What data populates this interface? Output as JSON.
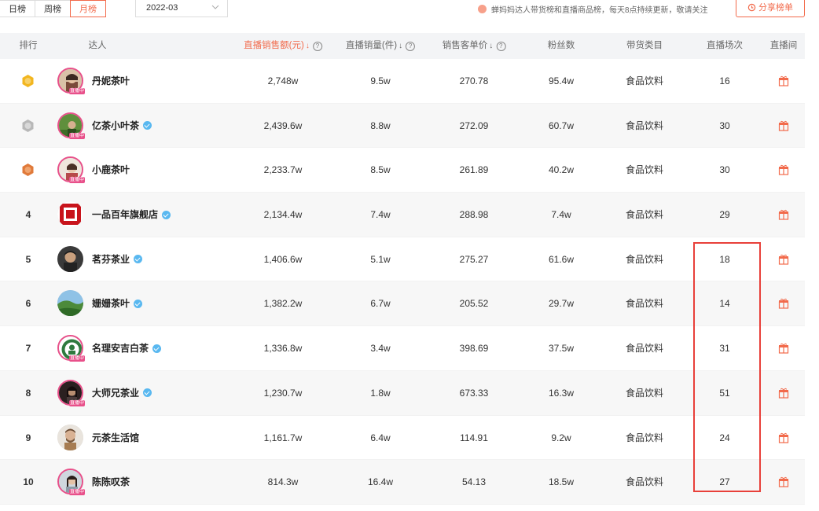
{
  "tabs": [
    {
      "label": "日榜",
      "active": false
    },
    {
      "label": "周榜",
      "active": false
    },
    {
      "label": "月榜",
      "active": true
    }
  ],
  "date_select": {
    "value": "2022-03"
  },
  "notice": "蝉妈妈达人带货榜和直播商品榜，每天8点持续更新，敬请关注",
  "share_button": "分享榜单",
  "columns": {
    "rank": "排行",
    "talent": "达人",
    "sales": "直播销售额(元)",
    "volume": "直播销量(件)",
    "unit_price": "销售客单价",
    "fans": "粉丝数",
    "category": "带货类目",
    "sessions": "直播场次",
    "room": "直播间"
  },
  "live_badge": "直播中",
  "rows": [
    {
      "rank": "1",
      "name": "丹妮茶叶",
      "verified": false,
      "live": true,
      "sales": "2,748w",
      "volume": "9.5w",
      "unit_price": "270.78",
      "fans": "95.4w",
      "category": "食品饮料",
      "sessions": "16"
    },
    {
      "rank": "2",
      "name": "亿茶小叶茶",
      "verified": true,
      "live": true,
      "sales": "2,439.6w",
      "volume": "8.8w",
      "unit_price": "272.09",
      "fans": "60.7w",
      "category": "食品饮料",
      "sessions": "30"
    },
    {
      "rank": "3",
      "name": "小鹿茶叶",
      "verified": false,
      "live": true,
      "sales": "2,233.7w",
      "volume": "8.5w",
      "unit_price": "261.89",
      "fans": "40.2w",
      "category": "食品饮料",
      "sessions": "30"
    },
    {
      "rank": "4",
      "name": "一品百年旗舰店",
      "verified": true,
      "live": false,
      "sales": "2,134.4w",
      "volume": "7.4w",
      "unit_price": "288.98",
      "fans": "7.4w",
      "category": "食品饮料",
      "sessions": "29"
    },
    {
      "rank": "5",
      "name": "茗芬茶业",
      "verified": true,
      "live": false,
      "sales": "1,406.6w",
      "volume": "5.1w",
      "unit_price": "275.27",
      "fans": "61.6w",
      "category": "食品饮料",
      "sessions": "18"
    },
    {
      "rank": "6",
      "name": "姗姗茶叶",
      "verified": true,
      "live": false,
      "sales": "1,382.2w",
      "volume": "6.7w",
      "unit_price": "205.52",
      "fans": "29.7w",
      "category": "食品饮料",
      "sessions": "14"
    },
    {
      "rank": "7",
      "name": "名理安吉白茶",
      "verified": true,
      "live": true,
      "sales": "1,336.8w",
      "volume": "3.4w",
      "unit_price": "398.69",
      "fans": "37.5w",
      "category": "食品饮料",
      "sessions": "31"
    },
    {
      "rank": "8",
      "name": "大师兄茶业",
      "verified": true,
      "live": true,
      "sales": "1,230.7w",
      "volume": "1.8w",
      "unit_price": "673.33",
      "fans": "16.3w",
      "category": "食品饮料",
      "sessions": "51"
    },
    {
      "rank": "9",
      "name": "元茶生活馆",
      "verified": false,
      "live": false,
      "sales": "1,161.7w",
      "volume": "6.4w",
      "unit_price": "114.91",
      "fans": "9.2w",
      "category": "食品饮料",
      "sessions": "24"
    },
    {
      "rank": "10",
      "name": "陈陈叹茶",
      "verified": false,
      "live": true,
      "sales": "814.3w",
      "volume": "16.4w",
      "unit_price": "54.13",
      "fans": "18.5w",
      "category": "食品饮料",
      "sessions": "27"
    }
  ],
  "colors": {
    "accent": "#f26a4b",
    "live_border": "#e8508a",
    "verified": "#59b8f0",
    "highlight_box": "#e8403a",
    "gold": "#f2b61f",
    "silver": "#b8b8b8",
    "bronze": "#e07a3a"
  }
}
